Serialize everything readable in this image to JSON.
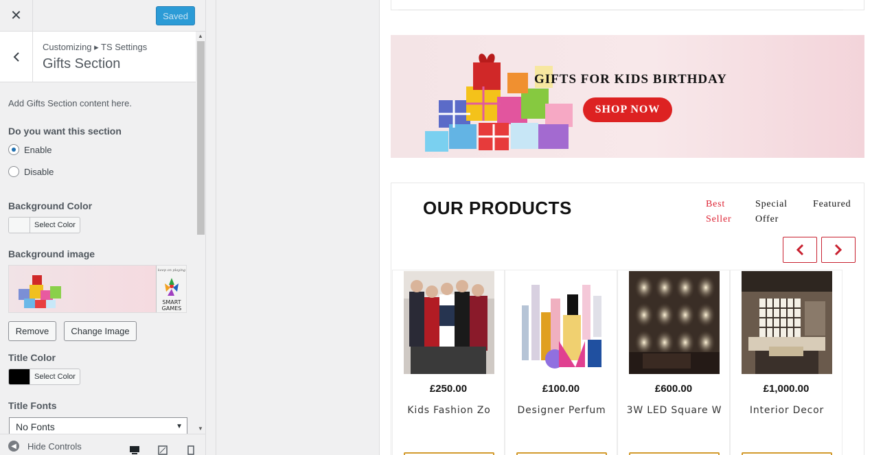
{
  "header": {
    "saved_label": "Saved"
  },
  "section": {
    "breadcrumb": "Customizing ▸ TS Settings",
    "title": "Gifts Section",
    "description": "Add Gifts Section content here."
  },
  "controls": {
    "enable_question": "Do you want this section",
    "enable_option": "Enable",
    "disable_option": "Disable",
    "bg_color_label": "Background Color",
    "bg_color_button": "Select Color",
    "bg_color_value": "#f6f7f7",
    "bg_image_label": "Background image",
    "remove_label": "Remove",
    "change_image_label": "Change Image",
    "title_color_label": "Title Color",
    "title_color_button": "Select Color",
    "title_color_value": "#000000",
    "title_fonts_label": "Title Fonts",
    "title_fonts_value": "No Fonts",
    "logo_text": "keep on playing",
    "logo_brand": "SMART GAMES"
  },
  "footer": {
    "hide_controls": "Hide Controls"
  },
  "preview": {
    "banner_title": "GIFTS FOR KIDS BIRTHDAY",
    "banner_button": "SHOP NOW",
    "products_title": "OUR PRODUCTS",
    "tabs": [
      {
        "line1": "Best",
        "line2": "Seller"
      },
      {
        "line1": "Special",
        "line2": "Offer"
      },
      {
        "line1": "Featured",
        "line2": ""
      }
    ],
    "products": [
      {
        "price": "£250.00",
        "name": "Kids Fashion Zo"
      },
      {
        "price": "£100.00",
        "name": "Designer Perfum"
      },
      {
        "price": "£600.00",
        "name": "3W LED Square W"
      },
      {
        "price": "£1,000.00",
        "name": "Interior Decor"
      }
    ],
    "accent_color": "#dd2222"
  }
}
